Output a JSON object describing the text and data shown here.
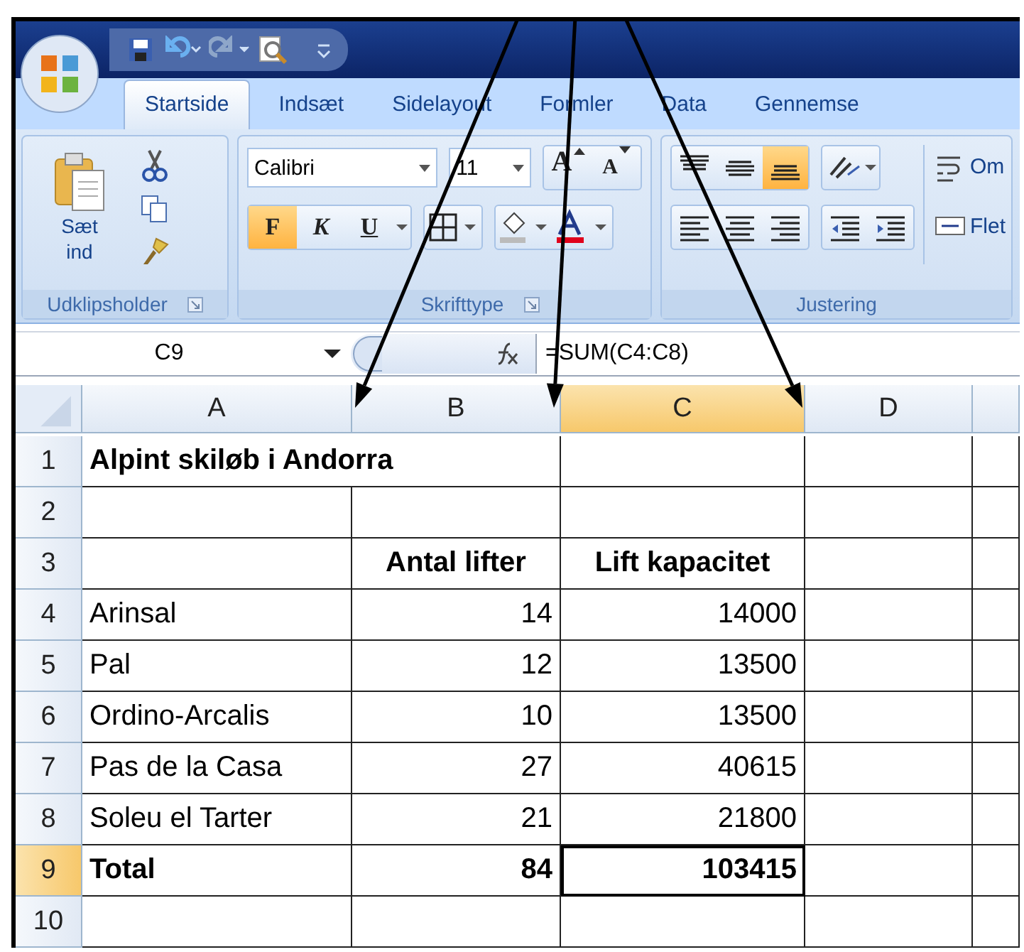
{
  "tabs": [
    {
      "label": "Startside",
      "selected": true
    },
    {
      "label": "Indsæt",
      "selected": false
    },
    {
      "label": "Sidelayout",
      "selected": false
    },
    {
      "label": "Formler",
      "selected": false
    },
    {
      "label": "Data",
      "selected": false
    },
    {
      "label": "Gennemse",
      "selected": false
    }
  ],
  "ribbon": {
    "clipboard": {
      "paste_label": "Sæt\nind",
      "group_label": "Udklipsholder"
    },
    "font": {
      "name": "Calibri",
      "size": "11",
      "grow_label": "A",
      "shrink_label": "A",
      "bold_button": "F",
      "italic_button": "K",
      "underline_button": "U",
      "bold_on": true,
      "group_label": "Skrifttype"
    },
    "alignment": {
      "bottom_align_on": true,
      "wrap_label": "Om",
      "merge_label": "Flet",
      "group_label": "Justering"
    }
  },
  "name_box": "C9",
  "formula": "=SUM(C4:C8)",
  "columns": [
    {
      "label": "A",
      "selected": false
    },
    {
      "label": "B",
      "selected": false
    },
    {
      "label": "C",
      "selected": true
    },
    {
      "label": "D",
      "selected": false
    }
  ],
  "rows": [
    {
      "number": "1",
      "kind": "title",
      "selected": false,
      "cells": [
        "Alpint skiløb i Andorra"
      ]
    },
    {
      "number": "2",
      "kind": "blank",
      "selected": false,
      "cells": []
    },
    {
      "number": "3",
      "kind": "heading",
      "selected": false,
      "cells": [
        "",
        "Antal lifter",
        "Lift kapacitet"
      ]
    },
    {
      "number": "4",
      "kind": "data",
      "selected": false,
      "cells": [
        "Arinsal",
        "14",
        "14000"
      ]
    },
    {
      "number": "5",
      "kind": "data",
      "selected": false,
      "cells": [
        "Pal",
        "12",
        "13500"
      ]
    },
    {
      "number": "6",
      "kind": "data",
      "selected": false,
      "cells": [
        "Ordino-Arcalis",
        "10",
        "13500"
      ]
    },
    {
      "number": "7",
      "kind": "data",
      "selected": false,
      "cells": [
        "Pas de la Casa",
        "27",
        "40615"
      ]
    },
    {
      "number": "8",
      "kind": "data",
      "selected": false,
      "cells": [
        "Soleu el Tarter",
        "21",
        "21800"
      ]
    },
    {
      "number": "9",
      "kind": "total",
      "selected": true,
      "cells": [
        "Total",
        "84",
        "103415"
      ]
    },
    {
      "number": "10",
      "kind": "blank",
      "selected": false,
      "cells": []
    }
  ]
}
